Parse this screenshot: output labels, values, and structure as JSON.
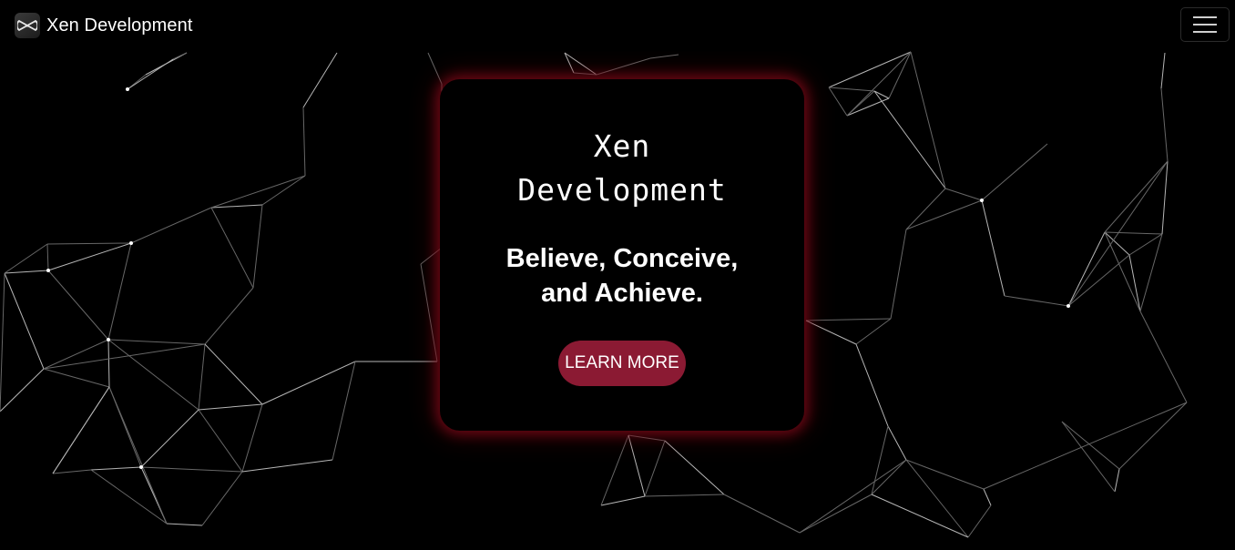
{
  "navbar": {
    "brand_name": "Xen Development",
    "logo_icon": "xen-infinity-logo-icon",
    "menu_icon": "hamburger-menu-icon"
  },
  "hero": {
    "title": "Xen Development",
    "tagline": "Believe, Conceive, and Achieve.",
    "cta_label": "LEARN MORE"
  },
  "colors": {
    "background": "#000000",
    "accent": "#8b1a33",
    "card_glow": "#870a19",
    "text": "#ffffff",
    "network_lines": "#9a9a9a"
  }
}
